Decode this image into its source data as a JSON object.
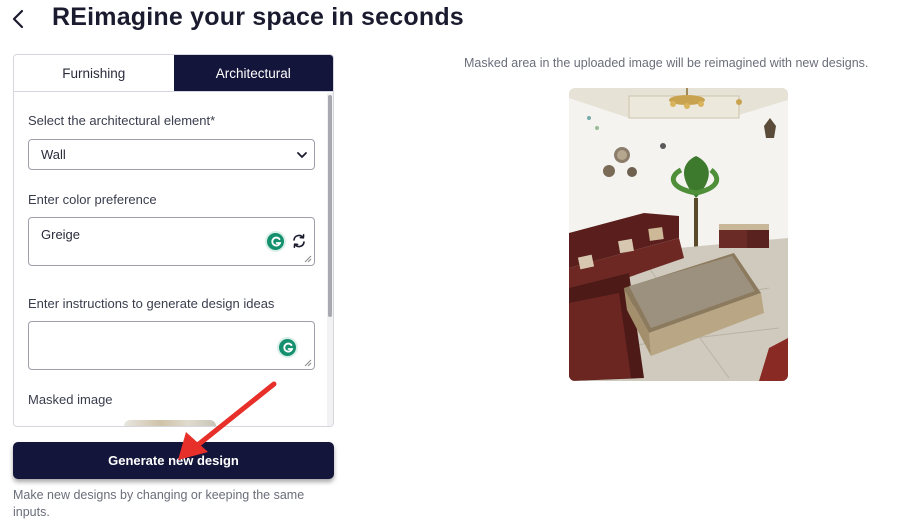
{
  "header": {
    "title": "REimagine your space in seconds",
    "back_icon": "chevron-left-icon"
  },
  "tabs": [
    {
      "label": "Furnishing",
      "active": false
    },
    {
      "label": "Architectural",
      "active": true
    }
  ],
  "form": {
    "element_label": "Select the architectural element*",
    "element_value": "Wall",
    "color_label": "Enter color preference",
    "color_value": "Greige",
    "instructions_label": "Enter instructions to generate design ideas",
    "instructions_value": "",
    "masked_label": "Masked image"
  },
  "actions": {
    "generate_label": "Generate new design",
    "helper_text": "Make new designs by changing or keeping the same inputs."
  },
  "preview": {
    "note": "Masked area in the uploaded image will be reimagined with new designs."
  },
  "colors": {
    "accent_dark": "#13153a",
    "grammarly_green": "#14906f",
    "annotation_arrow": "#e8302a"
  }
}
